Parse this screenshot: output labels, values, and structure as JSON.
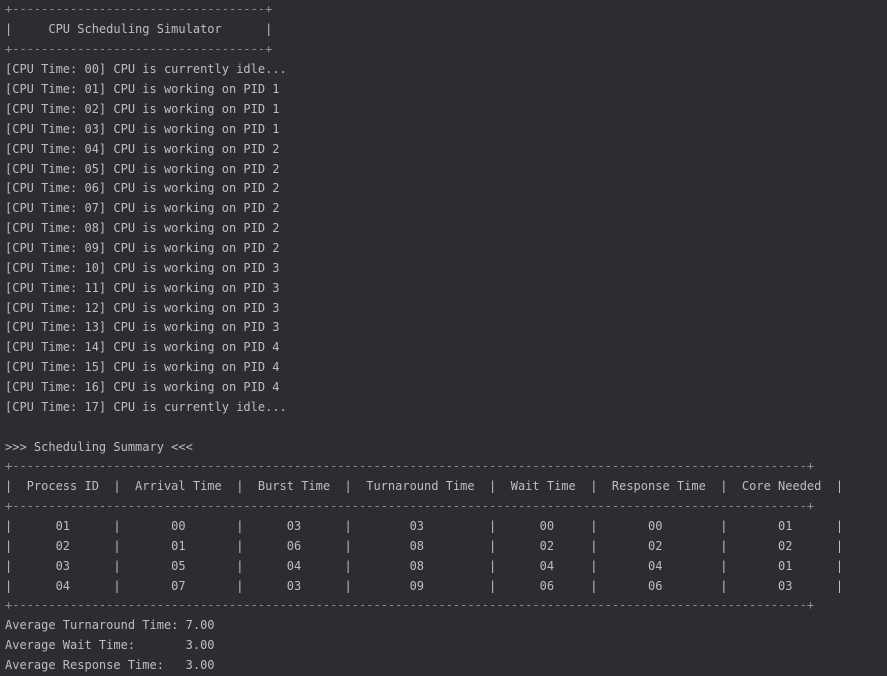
{
  "header": {
    "border": "+-----------------------------------+",
    "title_line": "|     CPU Scheduling Simulator      |"
  },
  "log": [
    "[CPU Time: 00] CPU is currently idle...",
    "[CPU Time: 01] CPU is working on PID 1",
    "[CPU Time: 02] CPU is working on PID 1",
    "[CPU Time: 03] CPU is working on PID 1",
    "[CPU Time: 04] CPU is working on PID 2",
    "[CPU Time: 05] CPU is working on PID 2",
    "[CPU Time: 06] CPU is working on PID 2",
    "[CPU Time: 07] CPU is working on PID 2",
    "[CPU Time: 08] CPU is working on PID 2",
    "[CPU Time: 09] CPU is working on PID 2",
    "[CPU Time: 10] CPU is working on PID 3",
    "[CPU Time: 11] CPU is working on PID 3",
    "[CPU Time: 12] CPU is working on PID 3",
    "[CPU Time: 13] CPU is working on PID 3",
    "[CPU Time: 14] CPU is working on PID 4",
    "[CPU Time: 15] CPU is working on PID 4",
    "[CPU Time: 16] CPU is working on PID 4",
    "[CPU Time: 17] CPU is currently idle..."
  ],
  "summary": {
    "heading": ">>> Scheduling Summary <<<",
    "border": "+--------------------------------------------------------------------------------------------------------------+",
    "header_row": "|  Process ID  |  Arrival Time  |  Burst Time  |  Turnaround Time  |  Wait Time  |  Response Time  |  Core Needed  |",
    "rows": [
      "|      01      |       00       |      03      |        03         |      00     |       00        |       01      |",
      "|      02      |       01       |      06      |        08         |      02     |       02        |       02      |",
      "|      03      |       05       |      04      |        08         |      04     |       04        |       01      |",
      "|      04      |       07       |      03      |        09         |      06     |       06        |       03      |"
    ],
    "averages": [
      "Average Turnaround Time: 7.00",
      "Average Wait Time:       3.00",
      "Average Response Time:   3.00"
    ]
  }
}
